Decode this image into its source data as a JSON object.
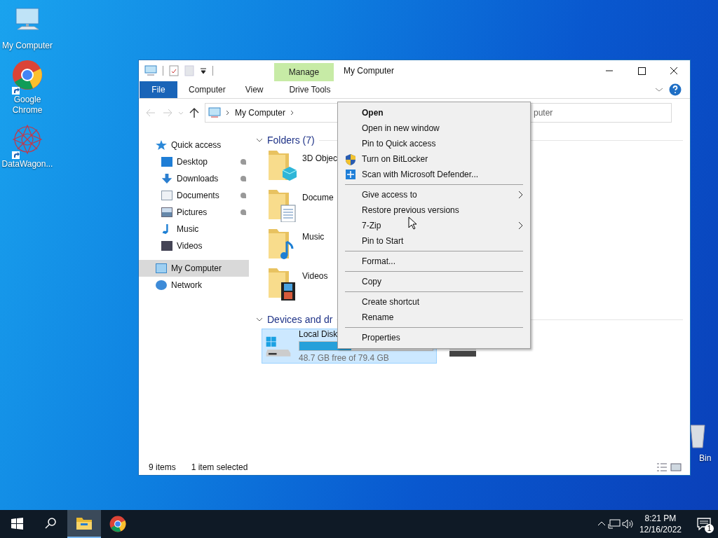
{
  "desktop_icons": [
    {
      "label": "My Computer",
      "kind": "computer",
      "shortcut": false
    },
    {
      "label": "Google Chrome",
      "kind": "browser",
      "shortcut": true
    },
    {
      "label": "DataWagon...",
      "kind": "app",
      "shortcut": true
    }
  ],
  "recycle_bin": {
    "label": "Bin"
  },
  "window": {
    "title": "My Computer",
    "contextual_group": "Manage",
    "ribbon_tabs": [
      {
        "label": "File",
        "kind": "file",
        "selected": false
      },
      {
        "label": "Computer",
        "kind": "tab",
        "selected": false
      },
      {
        "label": "View",
        "kind": "tab",
        "selected": false
      },
      {
        "label": "Drive Tools",
        "kind": "contextual",
        "selected": false
      }
    ],
    "address": {
      "crumbs": [
        "My Computer"
      ]
    },
    "search": {
      "placeholder": "puter"
    },
    "nav": [
      {
        "label": "Quick access",
        "kind": "quick",
        "selected": false,
        "pinned": false,
        "children": [
          {
            "label": "Desktop",
            "kind": "desktop",
            "selected": false,
            "pinned": true
          },
          {
            "label": "Downloads",
            "kind": "downloads",
            "selected": false,
            "pinned": true
          },
          {
            "label": "Documents",
            "kind": "documents",
            "selected": false,
            "pinned": true
          },
          {
            "label": "Pictures",
            "kind": "pictures",
            "selected": false,
            "pinned": true
          },
          {
            "label": "Music",
            "kind": "music",
            "selected": false,
            "pinned": false
          },
          {
            "label": "Videos",
            "kind": "videos",
            "selected": false,
            "pinned": false
          }
        ]
      },
      {
        "label": "My Computer",
        "kind": "computer",
        "selected": true,
        "pinned": false
      },
      {
        "label": "Network",
        "kind": "network",
        "selected": false,
        "pinned": false
      }
    ],
    "folders": {
      "title": "Folders (7)",
      "expanded": true,
      "items": [
        {
          "label": "3D Objec",
          "kind": "objects"
        },
        {
          "label": "Docume",
          "kind": "documents"
        },
        {
          "label": "Music",
          "kind": "music"
        },
        {
          "label": "Videos",
          "kind": "videos"
        }
      ]
    },
    "devices": {
      "title": "Devices and dr",
      "expanded": true,
      "drives": [
        {
          "label": "Local Disk",
          "kind": "system",
          "selected": true,
          "level": 0.39,
          "free": "48.7 GB free of 79.4 GB"
        },
        {
          "kind": "optical",
          "selected": false
        }
      ]
    },
    "status_bar": {
      "count": "9 items",
      "selection": "1 item selected"
    }
  },
  "context_menu": [
    {
      "kind": "item",
      "label": "Open",
      "default": true,
      "submenu": false
    },
    {
      "kind": "item",
      "label": "Open in new window",
      "default": false,
      "submenu": false
    },
    {
      "kind": "item",
      "label": "Pin to Quick access",
      "default": false,
      "submenu": false
    },
    {
      "kind": "shield",
      "label": "Turn on BitLocker",
      "default": false,
      "submenu": false
    },
    {
      "kind": "defender",
      "label": "Scan with Microsoft Defender...",
      "default": false,
      "submenu": false
    },
    {
      "kind": "separator"
    },
    {
      "kind": "item",
      "label": "Give access to",
      "default": false,
      "submenu": true
    },
    {
      "kind": "item",
      "label": "Restore previous versions",
      "default": false,
      "submenu": false
    },
    {
      "kind": "item",
      "label": "7-Zip",
      "default": false,
      "submenu": true
    },
    {
      "kind": "item",
      "label": "Pin to Start",
      "default": false,
      "submenu": false
    },
    {
      "kind": "separator"
    },
    {
      "kind": "item",
      "label": "Format...",
      "default": false,
      "submenu": false
    },
    {
      "kind": "separator"
    },
    {
      "kind": "item",
      "label": "Copy",
      "default": false,
      "submenu": false
    },
    {
      "kind": "separator"
    },
    {
      "kind": "item",
      "label": "Create shortcut",
      "default": false,
      "submenu": false
    },
    {
      "kind": "item",
      "label": "Rename",
      "default": false,
      "submenu": false
    },
    {
      "kind": "separator"
    },
    {
      "kind": "item",
      "label": "Properties",
      "default": false,
      "submenu": false
    }
  ],
  "taskbar": {
    "apps": [
      {
        "kind": "explorer",
        "active": true
      },
      {
        "kind": "browser",
        "active": false
      }
    ],
    "time": "8:21 PM",
    "date": "12/16/2022",
    "notifications": "1"
  }
}
